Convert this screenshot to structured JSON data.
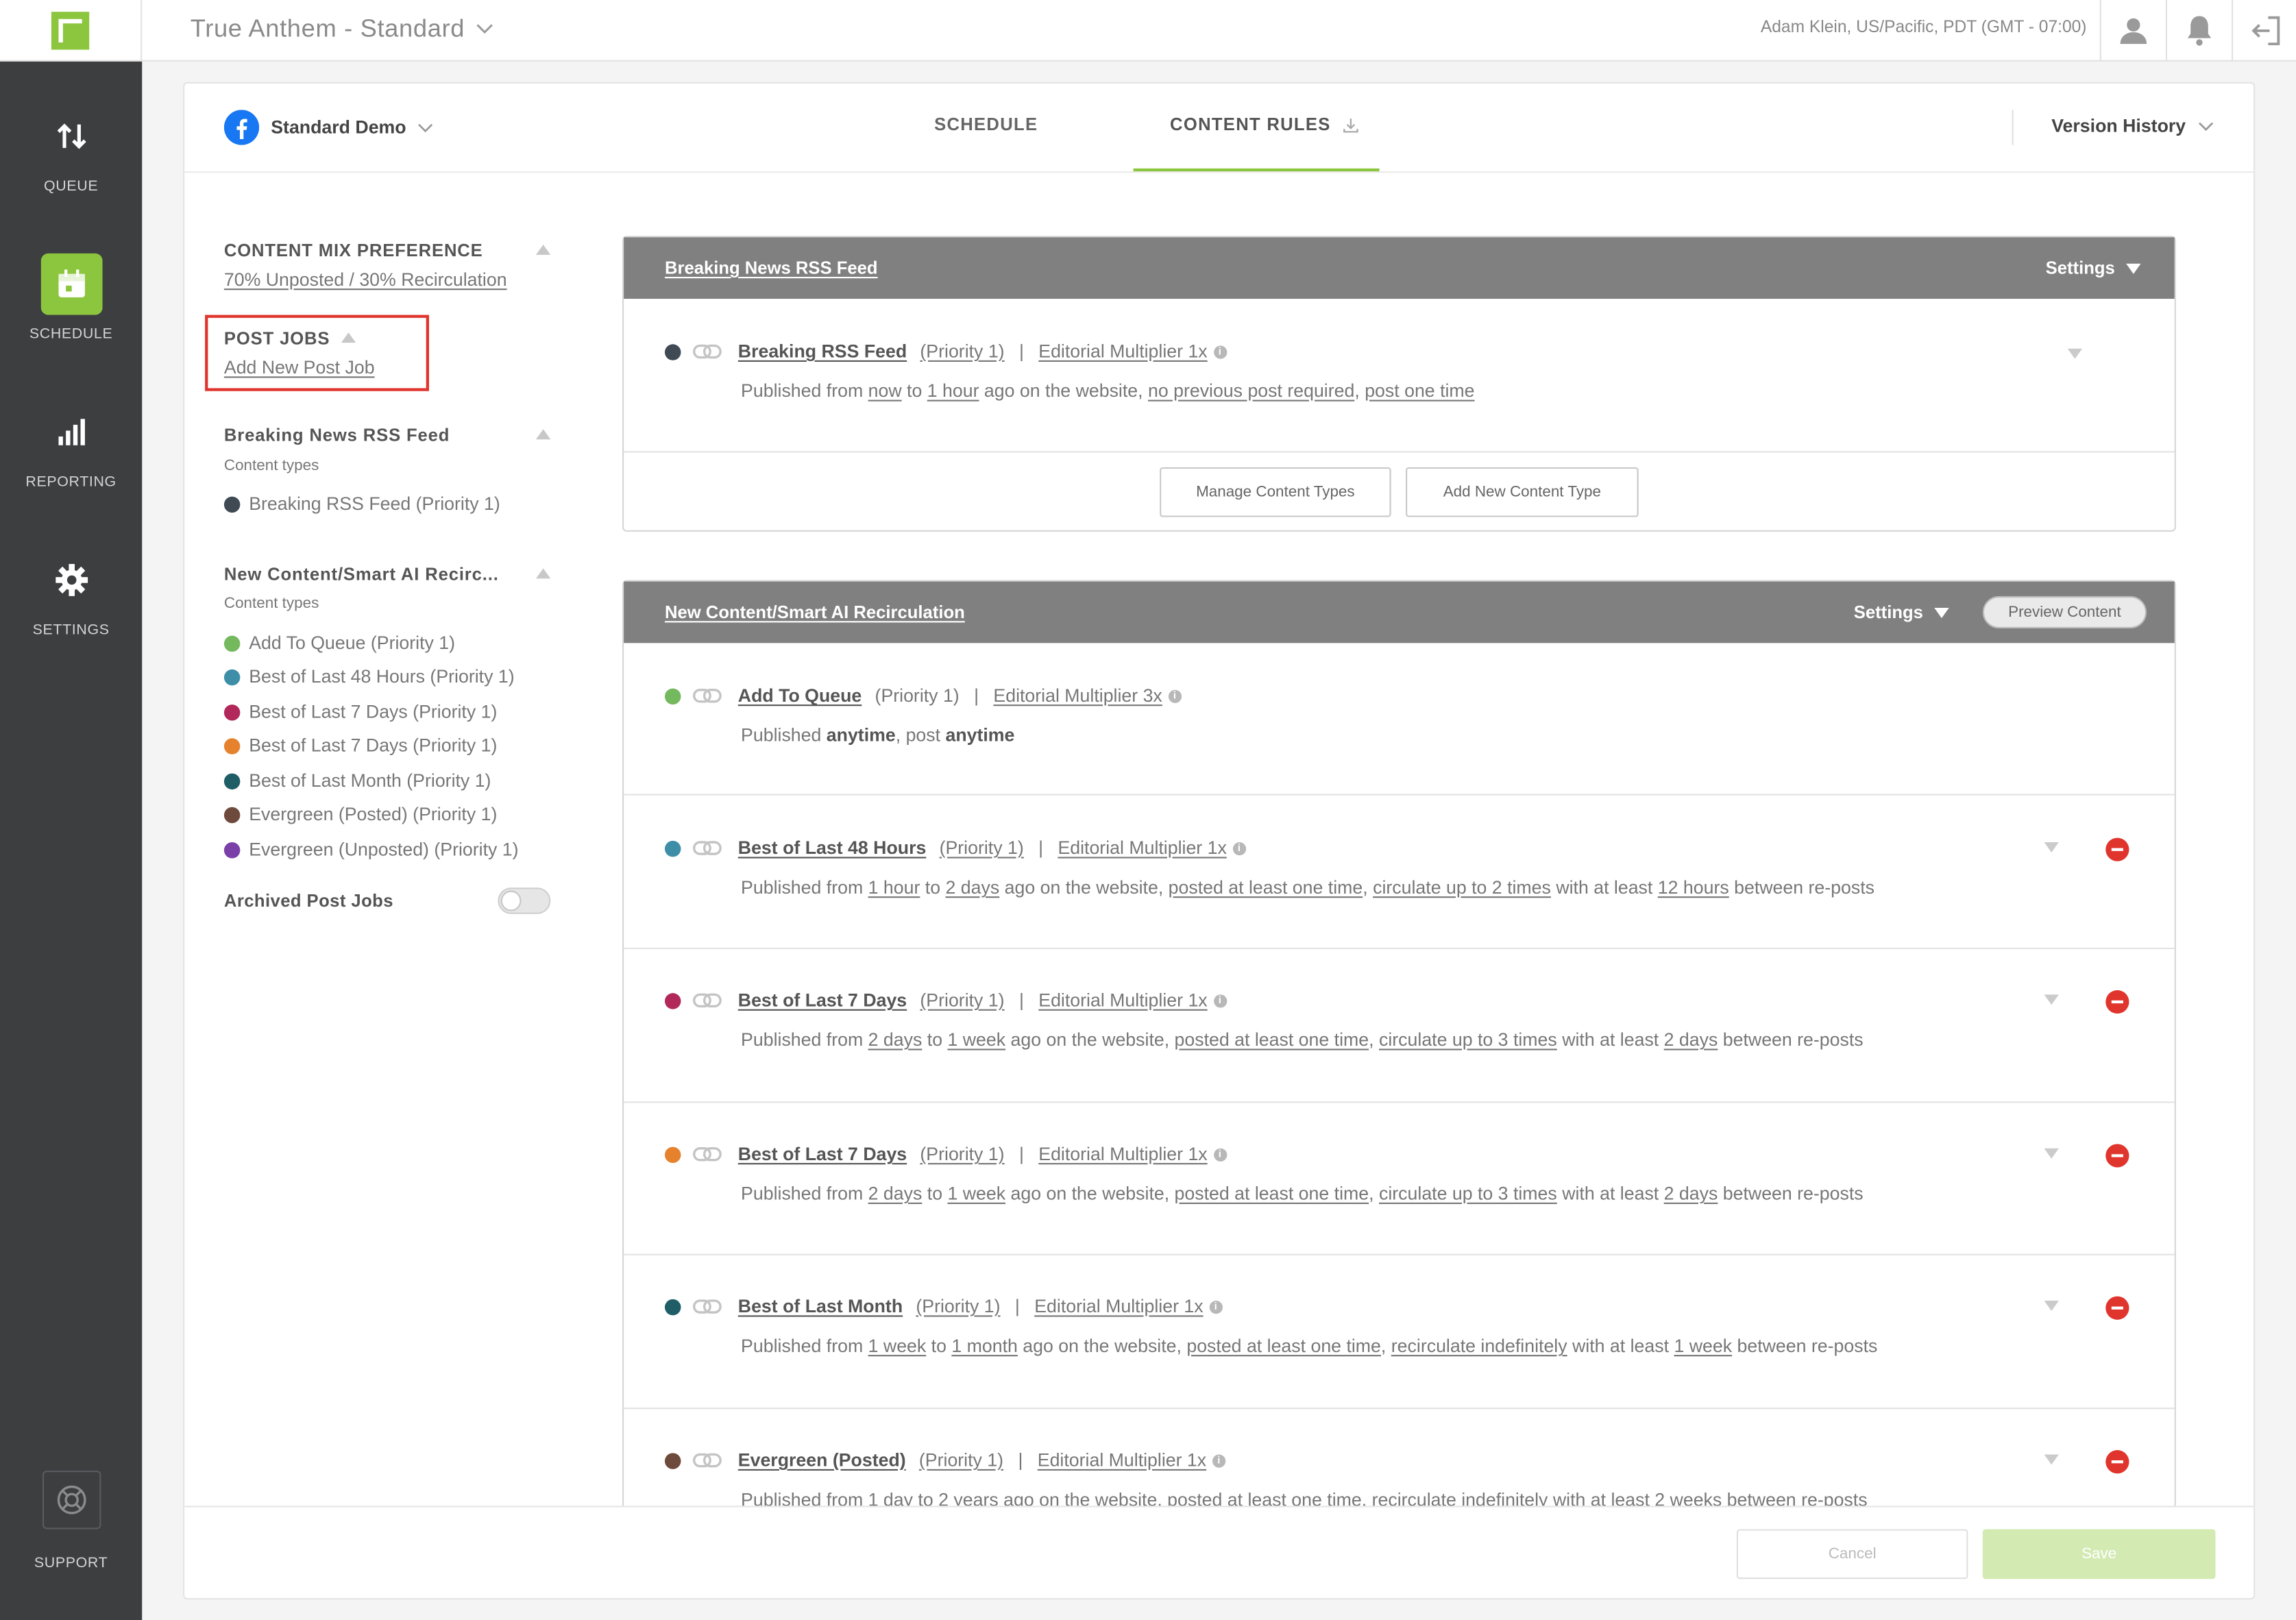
{
  "app": {
    "title": "True Anthem - Standard",
    "user": "Adam Klein, US/Pacific, PDT (GMT - 07:00)"
  },
  "nav": {
    "queue": "QUEUE",
    "schedule": "SCHEDULE",
    "reporting": "REPORTING",
    "settings": "SETTINGS",
    "support": "SUPPORT"
  },
  "header": {
    "account": "Standard Demo",
    "tab_schedule": "SCHEDULE",
    "tab_content_rules": "CONTENT RULES",
    "version_history": "Version History"
  },
  "left": {
    "content_mix_title": "CONTENT MIX PREFERENCE",
    "content_mix_value": "70% Unposted / 30% Recirculation",
    "post_jobs_title": "POST JOBS",
    "add_new_post_job": "Add New Post Job",
    "content_types_label": "Content types",
    "archived_label": "Archived Post Jobs",
    "groups": [
      {
        "title": "Breaking News RSS Feed",
        "items": [
          {
            "label": "Breaking RSS Feed (Priority 1)",
            "color": "#3f4a55"
          }
        ]
      },
      {
        "title": "New Content/Smart AI Recirc...",
        "items": [
          {
            "label": "Add To Queue (Priority 1)",
            "color": "#74b95e"
          },
          {
            "label": "Best of Last 48 Hours (Priority 1)",
            "color": "#3f8ea8"
          },
          {
            "label": "Best of Last 7 Days (Priority 1)",
            "color": "#b3285a"
          },
          {
            "label": "Best of Last 7 Days (Priority 1)",
            "color": "#e6822e"
          },
          {
            "label": "Best of Last Month (Priority 1)",
            "color": "#1f5e67"
          },
          {
            "label": "Evergreen (Posted) (Priority 1)",
            "color": "#6e4a3c"
          },
          {
            "label": "Evergreen (Unposted) (Priority 1)",
            "color": "#7b3fa8"
          }
        ]
      }
    ]
  },
  "breaking": {
    "title": "Breaking News RSS Feed",
    "settings": "Settings",
    "rule": {
      "name": "Breaking RSS Feed",
      "priority": "(Priority 1)",
      "multiplier": "Editorial Multiplier 1x",
      "color": "#3f4a55",
      "pre": "Published from ",
      "from": "now",
      "to_word": " to ",
      "to": "1 hour",
      "mid": " ago on the website, ",
      "p1": "no previous post required",
      "comma": ", ",
      "p2": "post one time"
    },
    "manage_btn": "Manage Content Types",
    "add_btn": "Add New Content Type"
  },
  "smart": {
    "title": "New Content/Smart AI Recirculation",
    "settings": "Settings",
    "preview": "Preview Content",
    "add_to_queue": {
      "name": "Add To Queue",
      "priority": "(Priority 1)",
      "multiplier": "Editorial Multiplier 3x",
      "color": "#74b95e",
      "pre": "Published ",
      "w1": "anytime",
      "mid": ", post ",
      "w2": "anytime"
    },
    "rules": [
      {
        "name": "Best of Last 48 Hours",
        "priority": "(Priority 1)",
        "multiplier": "Editorial Multiplier 1x",
        "color": "#3f8ea8",
        "from": "1 hour",
        "to": "2 days",
        "posted": "posted at least one time",
        "circ": "circulate up to 2 times",
        "gap": "12 hours"
      },
      {
        "name": "Best of Last 7 Days",
        "priority": "(Priority 1)",
        "multiplier": "Editorial Multiplier 1x",
        "color": "#b3285a",
        "from": "2 days",
        "to": "1 week",
        "posted": "posted at least one time",
        "circ": "circulate up to 3 times",
        "gap": "2 days"
      },
      {
        "name": "Best of Last 7 Days",
        "priority": "(Priority 1)",
        "multiplier": "Editorial Multiplier 1x",
        "color": "#e6822e",
        "from": "2 days",
        "to": "1 week",
        "posted": "posted at least one time",
        "circ": "circulate up to 3 times",
        "gap": "2 days"
      },
      {
        "name": "Best of Last Month",
        "priority": "(Priority 1)",
        "multiplier": "Editorial Multiplier 1x",
        "color": "#1f5e67",
        "from": "1 week",
        "to": "1 month",
        "posted": "posted at least one time",
        "circ": "recirculate indefinitely",
        "gap": "1 week"
      },
      {
        "name": "Evergreen (Posted)",
        "priority": "(Priority 1)",
        "multiplier": "Editorial Multiplier 1x",
        "color": "#6e4a3c",
        "from": "1 day",
        "to": "2 years",
        "posted": "posted at least one time",
        "circ": "recirculate indefinitely",
        "gap": "2 weeks"
      }
    ],
    "text": {
      "pre": "Published from ",
      "to_word": " to ",
      "mid": " ago on the website, ",
      "comma": ", ",
      "with": " with at least ",
      "post": " between re-posts"
    }
  },
  "footer": {
    "cancel": "Cancel",
    "save": "Save"
  }
}
